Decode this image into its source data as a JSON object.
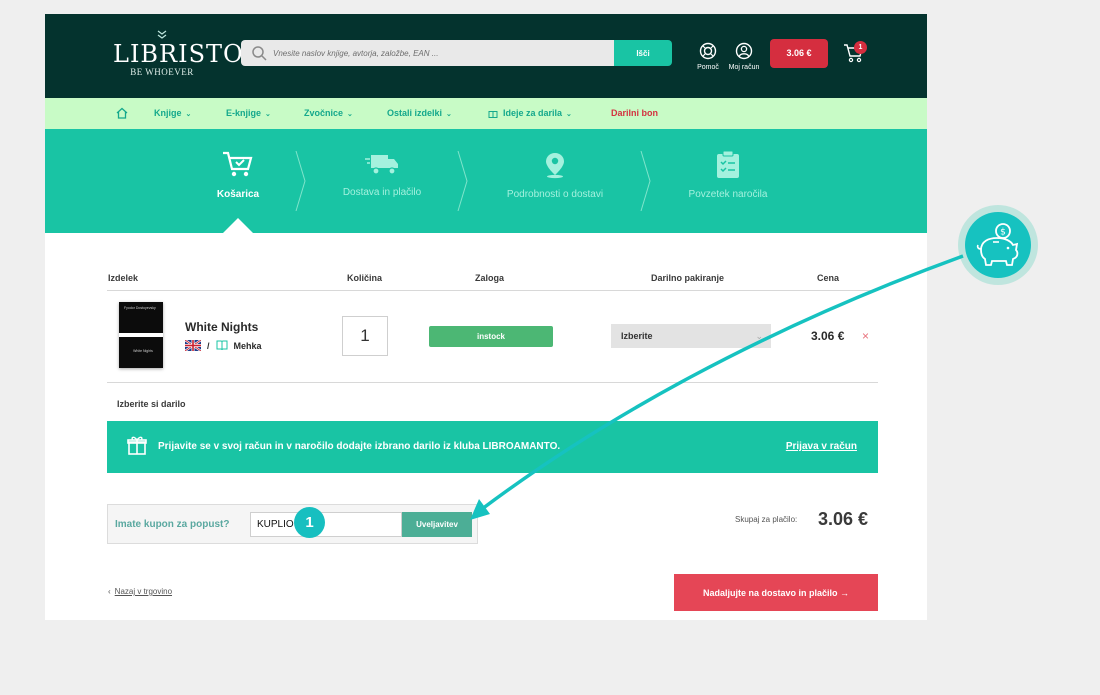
{
  "header": {
    "logo_name": "LIBRISTO",
    "logo_tagline": "BE WHOEVER",
    "search_placeholder": "Vnesite naslov knjige, avtorja, založbe, EAN ...",
    "search_button": "Išči",
    "help_label": "Pomoč",
    "account_label": "Moj račun",
    "cart_total": "3.06 €",
    "cart_count": "1"
  },
  "nav": {
    "items": [
      {
        "label": "Knjige"
      },
      {
        "label": "E-knjige"
      },
      {
        "label": "Zvočnice"
      },
      {
        "label": "Ostali izdelki"
      },
      {
        "label": "Ideje za darila"
      }
    ],
    "gift_voucher": "Darilni bon"
  },
  "steps": [
    {
      "label": "Košarica",
      "icon": "cart-check-icon",
      "active": true
    },
    {
      "label": "Dostava in plačilo",
      "icon": "truck-icon",
      "active": false
    },
    {
      "label": "Podrobnosti o dostavi",
      "icon": "location-pin-icon",
      "active": false
    },
    {
      "label": "Povzetek naročila",
      "icon": "clipboard-icon",
      "active": false
    }
  ],
  "table": {
    "headers": {
      "product": "Izdelek",
      "quantity": "Količina",
      "stock": "Zaloga",
      "gift_wrap": "Darilno pakiranje",
      "price": "Cena"
    },
    "rows": [
      {
        "title": "White Nights",
        "cover_author": "Fyodor Dostoyevsky",
        "cover_title": "White Nights",
        "language_flag": "uk-flag-icon",
        "separator": "/",
        "format": "Mehka",
        "quantity": "1",
        "stock": "instock",
        "gift_wrap_option": "Izberite",
        "price": "3.06 €",
        "remove": "×"
      }
    ]
  },
  "gift": {
    "choose_label": "Izberite si darilo",
    "banner_text": "Prijavite se v svoj račun in v naročilo dodajte izbrano darilo iz kluba LIBROAMANTO.",
    "login_link": "Prijava v račun"
  },
  "coupon": {
    "label": "Imate kupon za popust?",
    "value": "KUPLIO",
    "apply_button": "Uveljavitev"
  },
  "total": {
    "label": "Skupaj za plačilo:",
    "value": "3.06 €"
  },
  "footer": {
    "back_arrow": "‹",
    "back_link": "Nazaj v trgovino",
    "continue_button": "Nadaljujte na dostavo in plačilo →"
  },
  "annotation": {
    "badge_number": "1"
  },
  "colors": {
    "header_bg": "#04332e",
    "accent_teal": "#19c4a4",
    "nav_bg": "#c8fbc6",
    "cta_red": "#e54656",
    "cart_red": "#d52e3f",
    "stock_green": "#4cb774",
    "annotation_teal": "#16c2c0"
  }
}
